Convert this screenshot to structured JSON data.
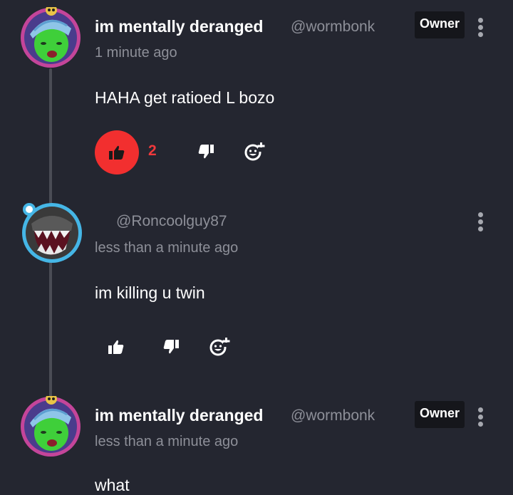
{
  "comments": [
    {
      "display_name": "im mentally deranged",
      "handle": "@wormbonk",
      "time": "1 minute ago",
      "text": "HAHA get ratioed L bozo",
      "badge": "Owner",
      "likes": "2",
      "liked": true,
      "avatar_icon": "green-frog-sleep-cap-avatar"
    },
    {
      "display_name": "",
      "handle": "@Roncoolguy87",
      "time": "less than a minute ago",
      "text": "im killing u twin",
      "avatar_icon": "dark-monster-teeth-avatar"
    },
    {
      "display_name": "im mentally deranged",
      "handle": "@wormbonk",
      "time": "less than a minute ago",
      "text": "what",
      "badge": "Owner",
      "avatar_icon": "green-frog-sleep-cap-avatar"
    }
  ],
  "colors": {
    "background": "#242630",
    "like_active": "#f22f2f",
    "muted_text": "#8d8f98",
    "badge_bg": "#15161b"
  },
  "icons": {
    "like": "thumbs-up-icon",
    "dislike": "thumbs-down-icon",
    "react": "add-emoji-icon",
    "more": "kebab-menu-icon"
  }
}
